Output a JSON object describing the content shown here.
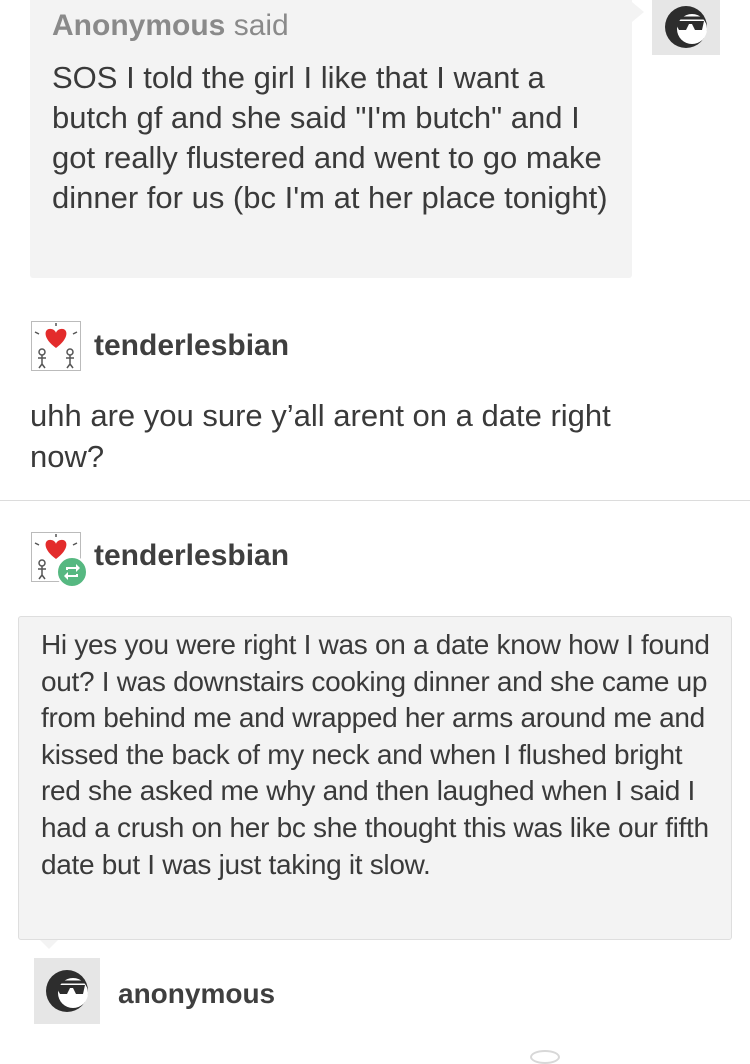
{
  "ask": {
    "asker_name": "Anonymous",
    "said_label": "said",
    "question": "SOS I told the girl I like that I want a butch gf and she said \"I'm butch\" and I got really flustered and went to go make dinner for us (bc I'm at her place tonight)",
    "avatar_icon": "sunglasses-face-icon"
  },
  "reply": {
    "username": "tenderlesbian",
    "avatar_icon": "heart-figures-icon",
    "text": "uhh are you sure y’all arent on a date right now?"
  },
  "reblog": {
    "username": "tenderlesbian",
    "avatar_icon": "heart-figures-icon",
    "badge_icon": "reblog-icon",
    "badge_color": "#56b881",
    "answer": "Hi yes you were right I was on a date know how I found out? I was downstairs cooking dinner and she came up from behind me and wrapped her arms around me and kissed the back of my neck and when I flushed bright red she asked me why and then laughed when I said I had a crush on her bc she thought this was like our fifth date but I was just taking it slow."
  },
  "footer": {
    "username": "anonymous",
    "avatar_icon": "sunglasses-face-icon"
  }
}
